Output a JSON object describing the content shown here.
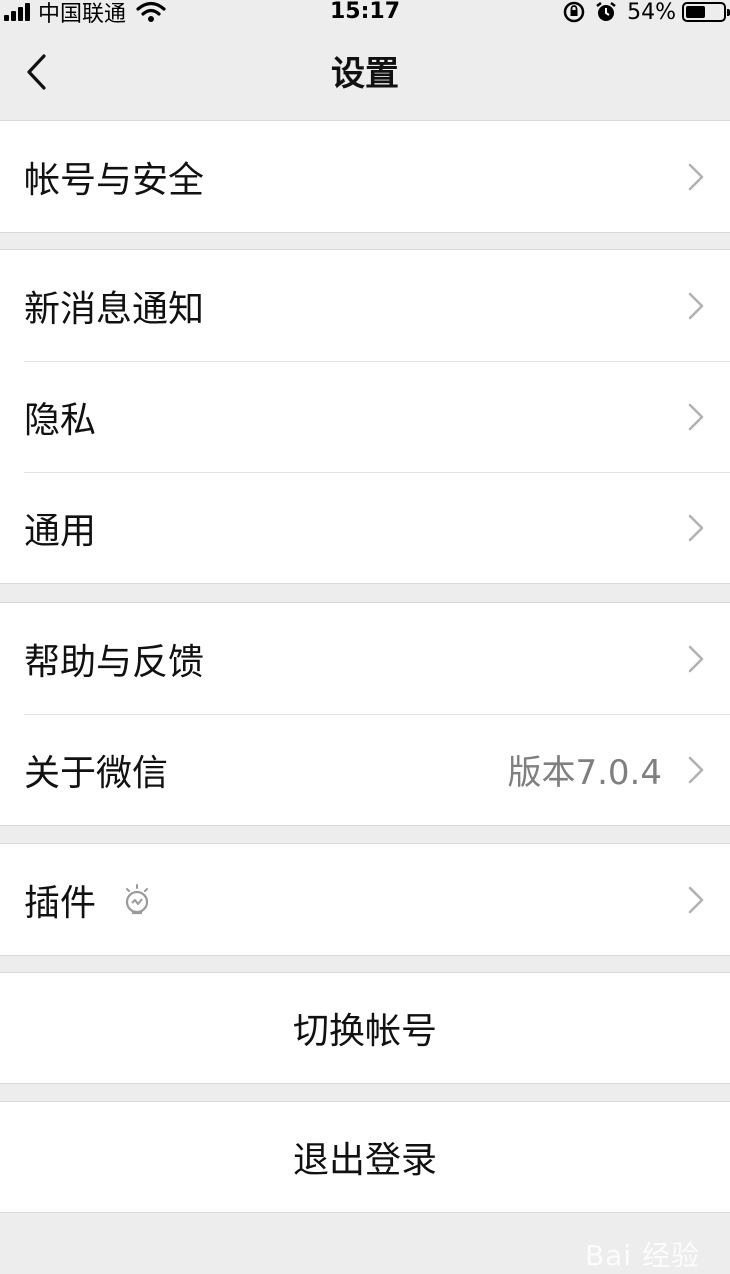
{
  "status_bar": {
    "carrier": "中国联通",
    "time": "15:17",
    "battery_percent": "54%",
    "battery_level": 0.54
  },
  "nav": {
    "title": "设置"
  },
  "groups": [
    {
      "items": [
        {
          "label": "帐号与安全"
        }
      ]
    },
    {
      "items": [
        {
          "label": "新消息通知"
        },
        {
          "label": "隐私"
        },
        {
          "label": "通用"
        }
      ]
    },
    {
      "items": [
        {
          "label": "帮助与反馈"
        },
        {
          "label": "关于微信",
          "detail": "版本7.0.4"
        }
      ]
    },
    {
      "items": [
        {
          "label": "插件"
        }
      ]
    }
  ],
  "actions": {
    "switch_account": "切换帐号",
    "logout": "退出登录"
  },
  "watermark": "Bai 经验",
  "icons": {
    "back": "chevron-left-icon",
    "chevron": "chevron-right-icon",
    "plugin": "lightbulb-icon"
  },
  "colors": {
    "background": "#ededed",
    "cell": "#ffffff",
    "text": "#111111",
    "secondary_text": "#7f7f7f",
    "chevron": "#b2b2b2"
  }
}
